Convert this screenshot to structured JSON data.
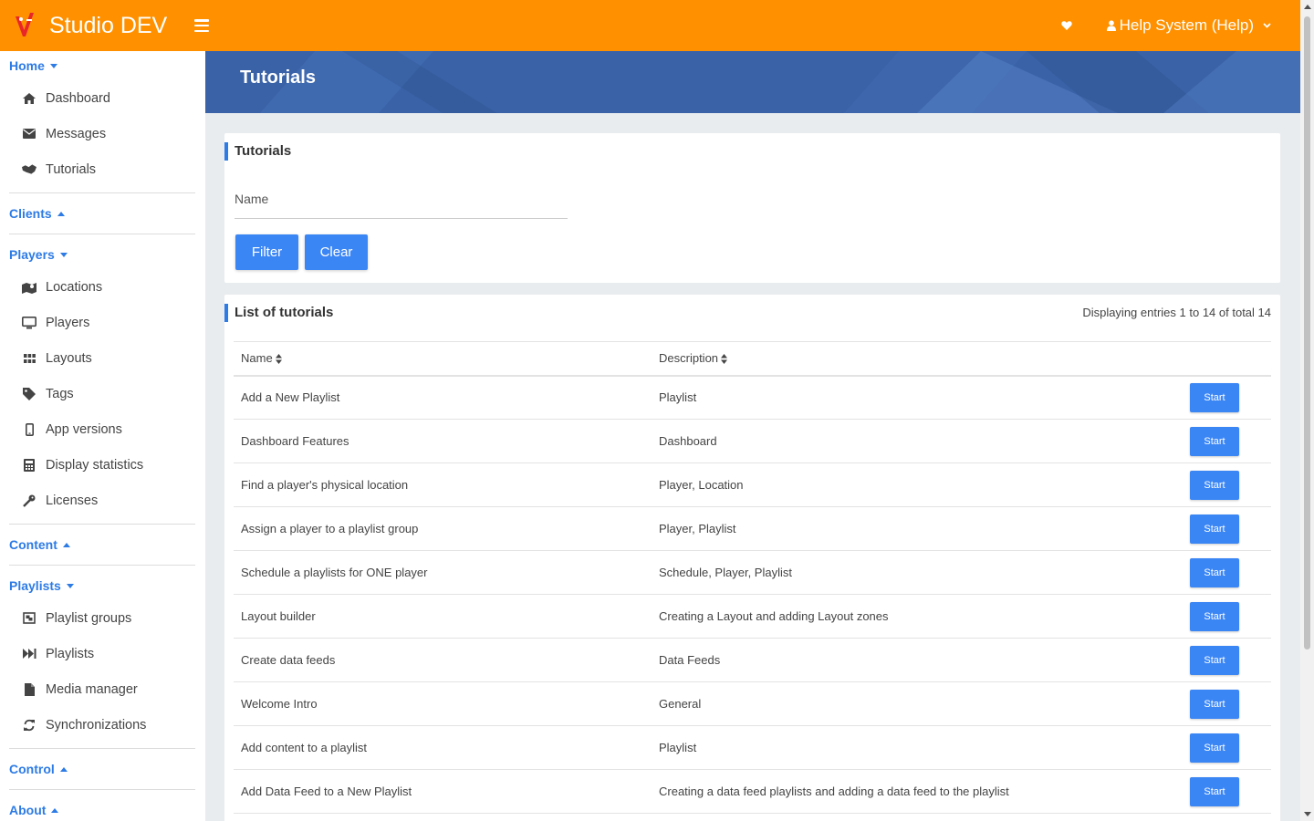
{
  "app": {
    "brand": "Studio DEV",
    "user_label": "Help System (Help)"
  },
  "colors": {
    "topbar": "#ff9100",
    "accent": "#2d7be5",
    "button": "#3b86f5",
    "banner": "#3a62a7"
  },
  "sidebar": {
    "sections": [
      {
        "label": "Home",
        "state": "expanded",
        "items": [
          {
            "label": "Dashboard",
            "icon": "home-icon"
          },
          {
            "label": "Messages",
            "icon": "envelope-icon"
          },
          {
            "label": "Tutorials",
            "icon": "handshake-icon"
          }
        ]
      },
      {
        "label": "Clients",
        "state": "collapsed",
        "items": []
      },
      {
        "label": "Players",
        "state": "expanded",
        "items": [
          {
            "label": "Locations",
            "icon": "map-marker-icon"
          },
          {
            "label": "Players",
            "icon": "monitor-icon"
          },
          {
            "label": "Layouts",
            "icon": "grid-icon"
          },
          {
            "label": "Tags",
            "icon": "tag-icon"
          },
          {
            "label": "App versions",
            "icon": "mobile-icon"
          },
          {
            "label": "Display statistics",
            "icon": "calculator-icon"
          },
          {
            "label": "Licenses",
            "icon": "key-icon"
          }
        ]
      },
      {
        "label": "Content",
        "state": "collapsed",
        "items": []
      },
      {
        "label": "Playlists",
        "state": "expanded",
        "items": [
          {
            "label": "Playlist groups",
            "icon": "object-group-icon"
          },
          {
            "label": "Playlists",
            "icon": "fast-forward-icon"
          },
          {
            "label": "Media manager",
            "icon": "file-icon"
          },
          {
            "label": "Synchronizations",
            "icon": "sync-icon"
          }
        ]
      },
      {
        "label": "Control",
        "state": "collapsed",
        "items": []
      },
      {
        "label": "About",
        "state": "collapsed",
        "items": []
      }
    ]
  },
  "banner": {
    "title": "Tutorials"
  },
  "filter": {
    "title": "Tutorials",
    "name_label": "Name",
    "name_value": "",
    "filter_label": "Filter",
    "clear_label": "Clear"
  },
  "list": {
    "title": "List of tutorials",
    "entries_info": "Displaying entries 1 to 14 of total 14",
    "columns": [
      "Name",
      "Description"
    ],
    "action_label": "Start",
    "rows": [
      {
        "name": "Add a New Playlist",
        "description": "Playlist"
      },
      {
        "name": "Dashboard Features",
        "description": "Dashboard"
      },
      {
        "name": "Find a player's physical location",
        "description": "Player, Location"
      },
      {
        "name": "Assign a player to a playlist group",
        "description": "Player, Playlist"
      },
      {
        "name": "Schedule a playlists for ONE player",
        "description": "Schedule, Player, Playlist"
      },
      {
        "name": "Layout builder",
        "description": "Creating a Layout and adding Layout zones"
      },
      {
        "name": "Create data feeds",
        "description": "Data Feeds"
      },
      {
        "name": "Welcome Intro",
        "description": "General"
      },
      {
        "name": "Add content to a playlist",
        "description": "Playlist"
      },
      {
        "name": "Add Data Feed to a New Playlist",
        "description": "Creating a data feed playlists and adding a data feed to the playlist"
      }
    ]
  }
}
